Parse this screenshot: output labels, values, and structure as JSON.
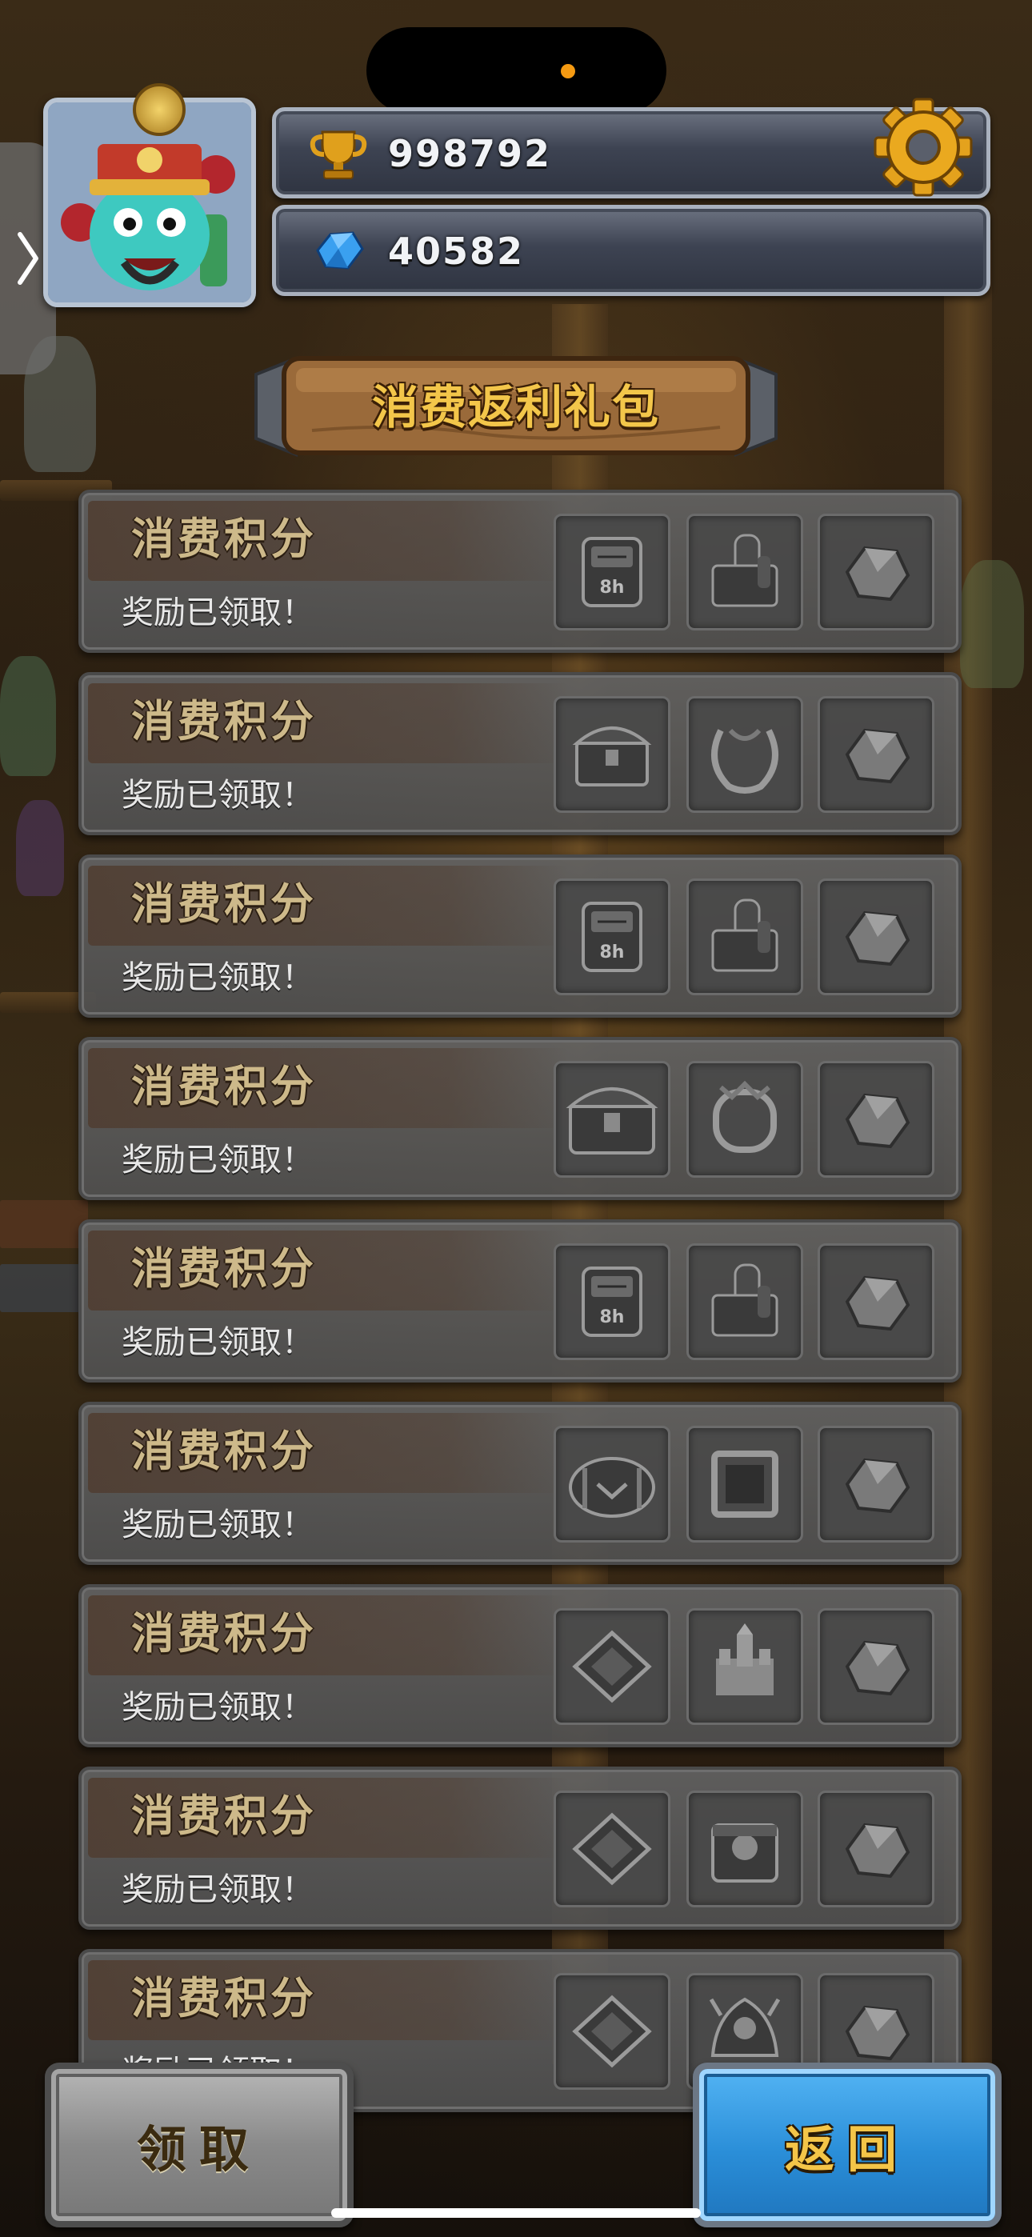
{
  "resources": {
    "trophy_value": "998792",
    "gem_value": "40582"
  },
  "title": "消费返利礼包",
  "rows": [
    {
      "title": "消费积分",
      "status": "奖励已领取！",
      "items": [
        "speedup-8h-icon",
        "factory-icon",
        "stone-icon"
      ]
    },
    {
      "title": "消费积分",
      "status": "奖励已领取！",
      "items": [
        "chest-icon",
        "laurel-frame-icon",
        "stone-icon"
      ]
    },
    {
      "title": "消费积分",
      "status": "奖励已领取！",
      "items": [
        "speedup-8h-icon",
        "factory-icon",
        "stone-icon"
      ]
    },
    {
      "title": "消费积分",
      "status": "奖励已领取！",
      "items": [
        "large-chest-icon",
        "ornate-frame-icon",
        "stone-icon"
      ]
    },
    {
      "title": "消费积分",
      "status": "奖励已领取！",
      "items": [
        "speedup-8h-icon",
        "factory-icon",
        "stone-icon"
      ]
    },
    {
      "title": "消费积分",
      "status": "奖励已领取！",
      "items": [
        "barrel-chest-icon",
        "square-frame-icon",
        "stone-icon"
      ]
    },
    {
      "title": "消费积分",
      "status": "奖励已领取！",
      "items": [
        "tile-icon",
        "castle-icon",
        "stone-icon"
      ]
    },
    {
      "title": "消费积分",
      "status": "奖励已领取！",
      "items": [
        "tile-icon",
        "skull-chest-icon",
        "stone-icon"
      ]
    },
    {
      "title": "消费积分",
      "status": "奖励已领取！",
      "items": [
        "tile-icon",
        "dragon-emblem-icon",
        "stone-icon"
      ]
    }
  ],
  "buttons": {
    "claim": "领取",
    "back": "返回"
  },
  "colors": {
    "title_gold": "#f3c64a",
    "back_button_blue": "#2a8ed8",
    "claim_button_gray": "#8a8a8a",
    "island_dot": "#f59a12"
  }
}
